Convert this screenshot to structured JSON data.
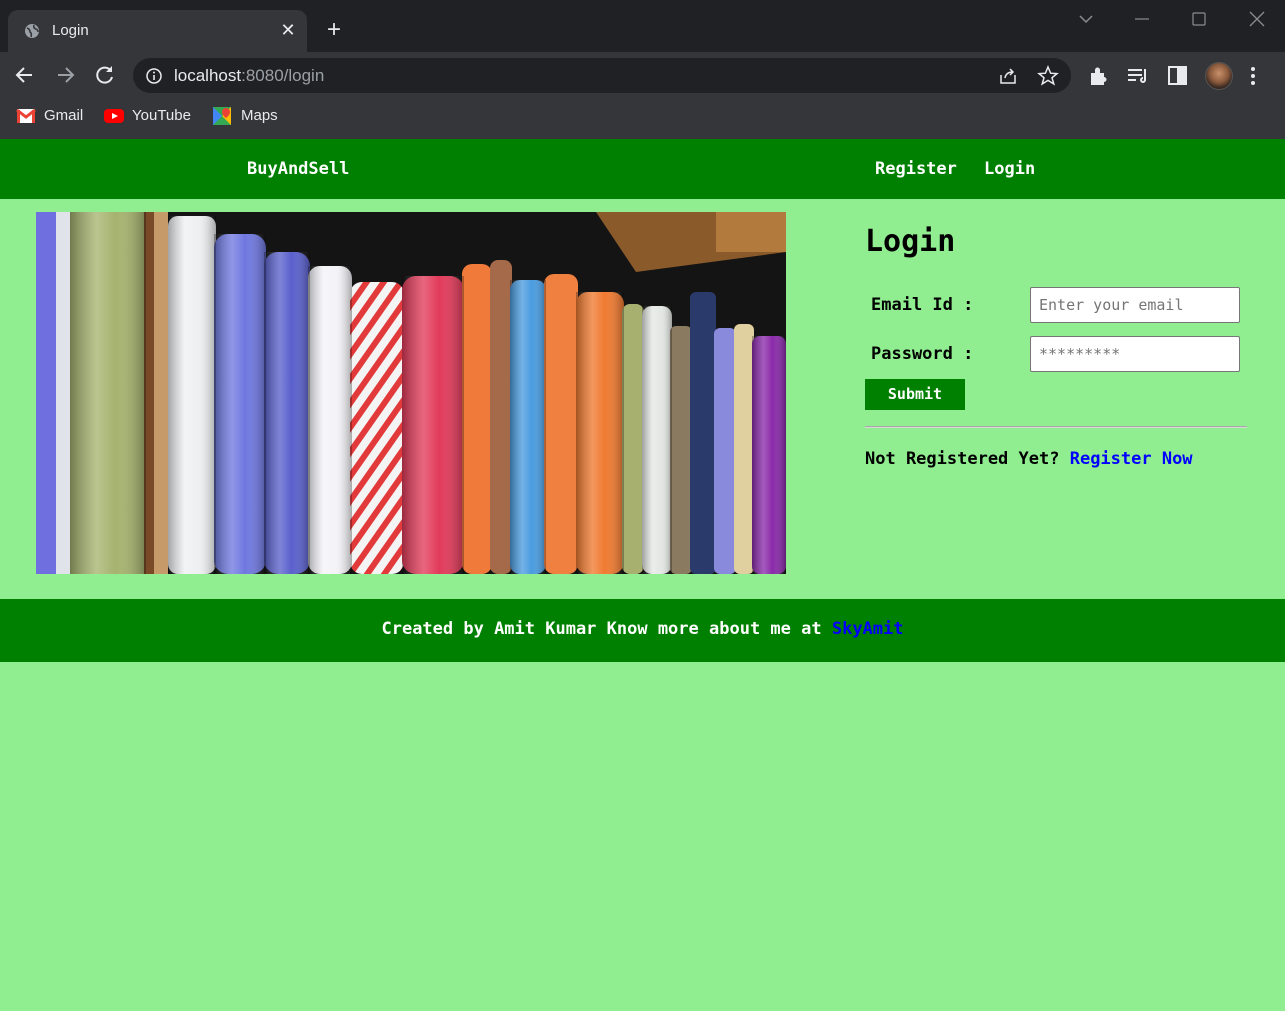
{
  "browser": {
    "tab_title": "Login",
    "url_host": "localhost",
    "url_rest": ":8080/login",
    "bookmarks": [
      {
        "label": "Gmail",
        "icon": "gmail-icon"
      },
      {
        "label": "YouTube",
        "icon": "youtube-icon"
      },
      {
        "label": "Maps",
        "icon": "maps-icon"
      }
    ]
  },
  "nav": {
    "brand": "BuyAndSell",
    "register": "Register",
    "login": "Login"
  },
  "login": {
    "title": "Login",
    "email_label": "Email Id :",
    "email_placeholder": "Enter your email",
    "password_label": "Password :",
    "password_placeholder": "*********",
    "submit": "Submit",
    "not_registered": "Not Registered Yet?",
    "register_now": "Register Now"
  },
  "footer": {
    "text": "Created by Amit Kumar Know more about me at",
    "link": "SkyAmit"
  },
  "colors": {
    "page_bg": "#90ee90",
    "nav_bg": "#008000",
    "link": "#0000ff"
  }
}
